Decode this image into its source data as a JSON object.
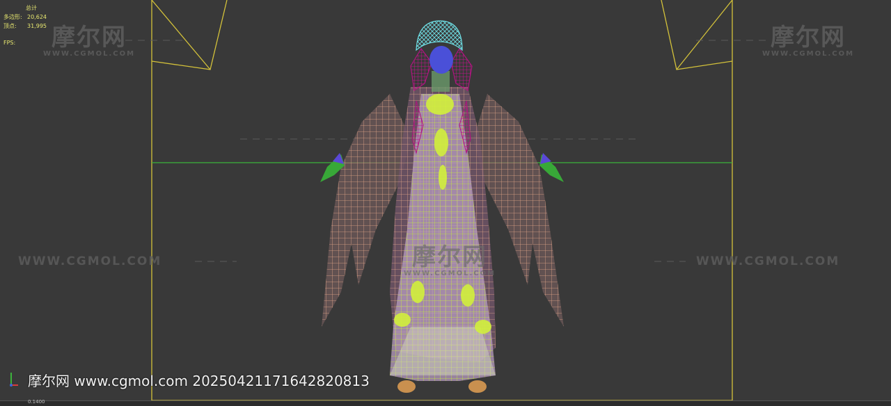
{
  "stats": {
    "title": "总计",
    "polys_label": "多边形:",
    "polys_value": "20,624",
    "verts_label": "顶点:",
    "verts_value": "31,995",
    "fps_label": "FPS:"
  },
  "watermarks": {
    "logo_text": "摩尔网",
    "logo_sub": "WWW.CGMOL.COM",
    "url_text": "WWW.CGMOL.COM",
    "bottom_text": "摩尔网 www.cgmol.com 20250421171642820813"
  },
  "status": {
    "text": "0.1400"
  },
  "colors": {
    "safe_frame": "#d4c23a",
    "horizon": "#3cb43c",
    "hair_top": "#6fe0e6",
    "hair_side": "#b0147f",
    "face": "#4a50d8",
    "robe_outer": "#e6a88a",
    "robe_inner": "#c6ec3a",
    "dress_fill": "#b89cc0",
    "hands": "#38a838"
  }
}
